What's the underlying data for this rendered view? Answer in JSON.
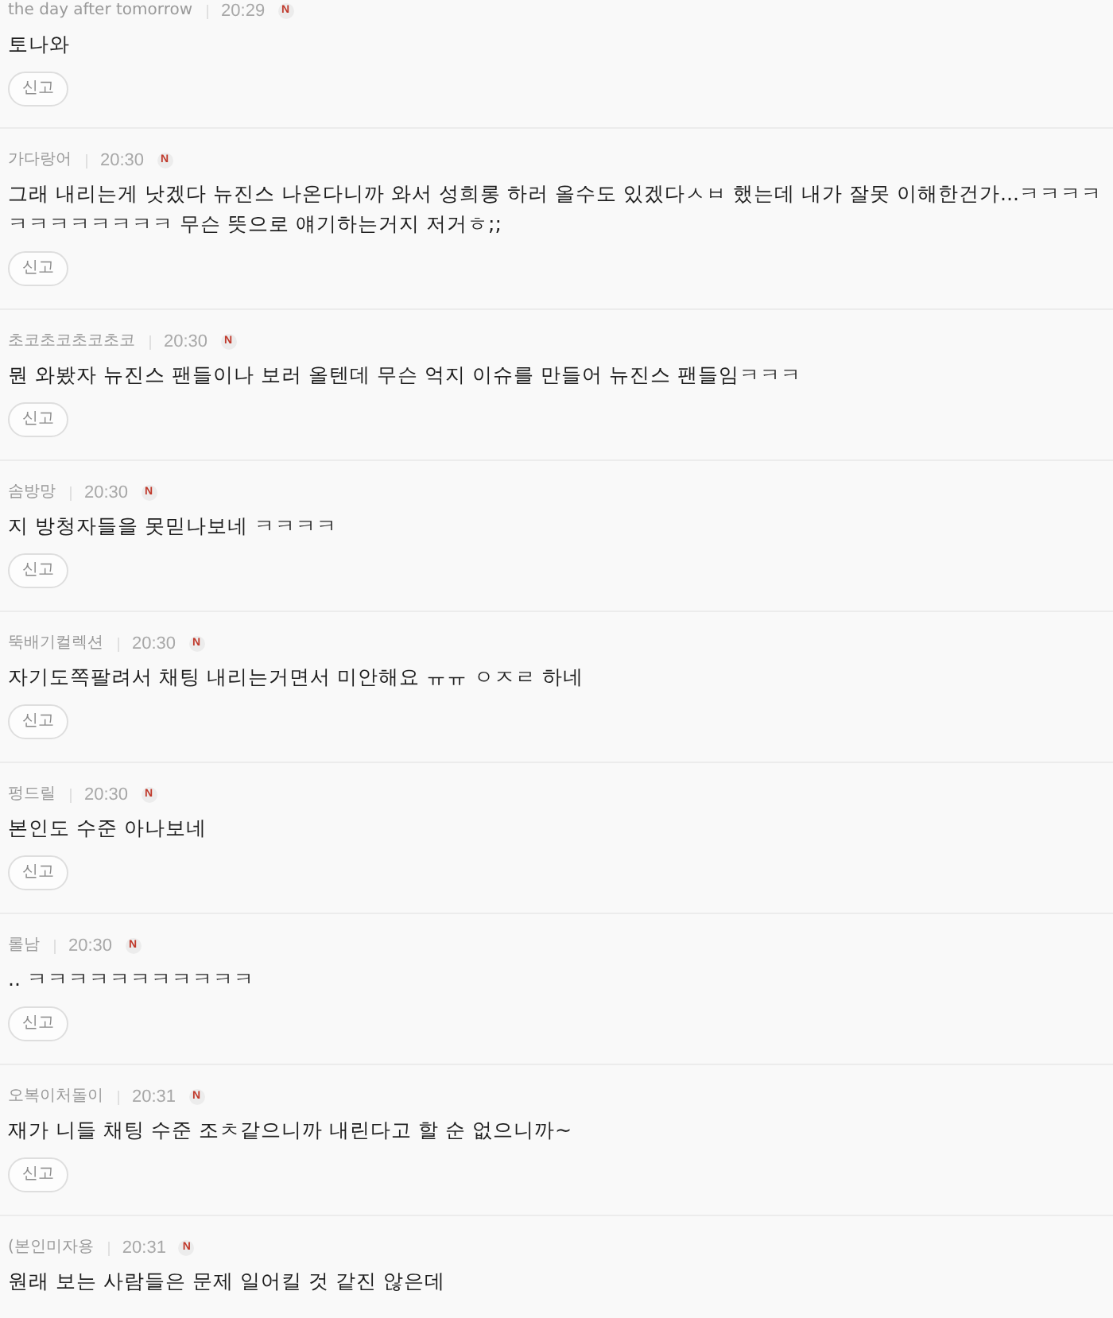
{
  "comments": [
    {
      "author": "the day after tomorrow",
      "time": "20:29",
      "badge": "N",
      "text": "토나와",
      "report_button": "신고"
    },
    {
      "author": "가다랑어",
      "time": "20:30",
      "badge": "N",
      "text": "그래 내리는게 낫겠다 뉴진스 나온다니까 와서 성희롱 하러 올수도 있겠다ㅅㅂ 했는데 내가 잘못 이해한건가...ㅋㅋㅋㅋㅋㅋㅋㅋㅋㅋㅋㅋ 무슨 뜻으로 얘기하는거지 저거ㅎ;;",
      "report_button": "신고"
    },
    {
      "author": "초코초코초코초코",
      "time": "20:30",
      "badge": "N",
      "text": "뭔 와봤자 뉴진스 팬들이나 보러 올텐데 무슨 억지 이슈를 만들어 뉴진스 팬들임ㅋㅋㅋ",
      "report_button": "신고"
    },
    {
      "author": "솜방망",
      "time": "20:30",
      "badge": "N",
      "text": "지 방청자들을 못믿나보네 ㅋㅋㅋㅋ",
      "report_button": "신고"
    },
    {
      "author": "뚝배기컬렉션",
      "time": "20:30",
      "badge": "N",
      "text": "자기도쪽팔려서 채팅 내리는거면서 미안해요 ㅠㅠ ㅇㅈㄹ 하네",
      "report_button": "신고"
    },
    {
      "author": "펑드릴",
      "time": "20:30",
      "badge": "N",
      "text": "본인도 수준 아나보네",
      "report_button": "신고"
    },
    {
      "author": "롤남",
      "time": "20:30",
      "badge": "N",
      "text": ".. ㅋㅋㅋㅋㅋㅋㅋㅋㅋㅋㅋ",
      "report_button": "신고"
    },
    {
      "author": "오복이처돌이",
      "time": "20:31",
      "badge": "N",
      "text": "재가 니들 채팅 수준 조ㅊ같으니까 내린다고 할 순 없으니까~",
      "report_button": "신고"
    },
    {
      "author": "(본인미자용",
      "time": "20:31",
      "badge": "N",
      "text": "원래 보는 사람들은 문제 일어킬 것 같진 않은데"
    }
  ]
}
